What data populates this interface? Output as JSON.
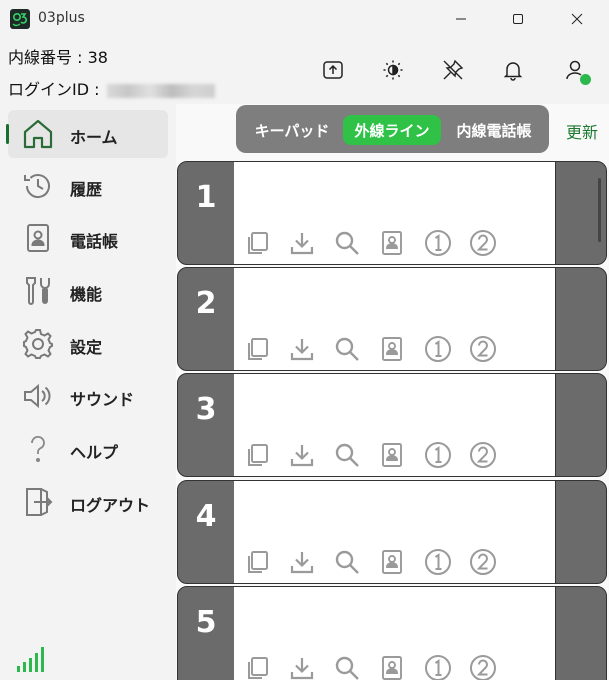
{
  "app": {
    "title": "03plus"
  },
  "window_controls": {
    "minimize": "minimize-icon",
    "maximize": "maximize-icon",
    "close": "close-icon"
  },
  "info": {
    "extension_label": "内線番号 : 38",
    "login_label": "ログインID : "
  },
  "toolbar": {
    "icons": [
      "upload-icon",
      "brightness-icon",
      "unpin-icon",
      "bell-icon",
      "user-icon"
    ],
    "status_color": "#2db84d"
  },
  "sidebar": {
    "items": [
      {
        "label": "ホーム",
        "icon": "home-icon",
        "active": true
      },
      {
        "label": "履歴",
        "icon": "history-icon",
        "active": false
      },
      {
        "label": "電話帳",
        "icon": "contacts-icon",
        "active": false
      },
      {
        "label": "機能",
        "icon": "tools-icon",
        "active": false
      },
      {
        "label": "設定",
        "icon": "gear-icon",
        "active": false
      },
      {
        "label": "サウンド",
        "icon": "speaker-icon",
        "active": false
      },
      {
        "label": "ヘルプ",
        "icon": "help-icon",
        "active": false
      },
      {
        "label": "ログアウト",
        "icon": "logout-icon",
        "active": false
      }
    ],
    "signal_icon": "signal-icon"
  },
  "tabs": [
    {
      "label": "キーパッド",
      "active": false
    },
    {
      "label": "外線ライン",
      "active": true
    },
    {
      "label": "内線電話帳",
      "active": false
    }
  ],
  "refresh_label": "更新",
  "lines": [
    {
      "number": "1"
    },
    {
      "number": "2"
    },
    {
      "number": "3"
    },
    {
      "number": "4"
    },
    {
      "number": "5"
    }
  ],
  "line_actions": [
    "copy-icon",
    "download-icon",
    "search-icon",
    "contact-card-icon",
    "circle-one-icon",
    "circle-two-icon"
  ],
  "colors": {
    "accent": "#2fc247",
    "segment_bg": "#7e7e7e",
    "line_gray": "#6b6b6b",
    "refresh": "#1d7a30"
  }
}
